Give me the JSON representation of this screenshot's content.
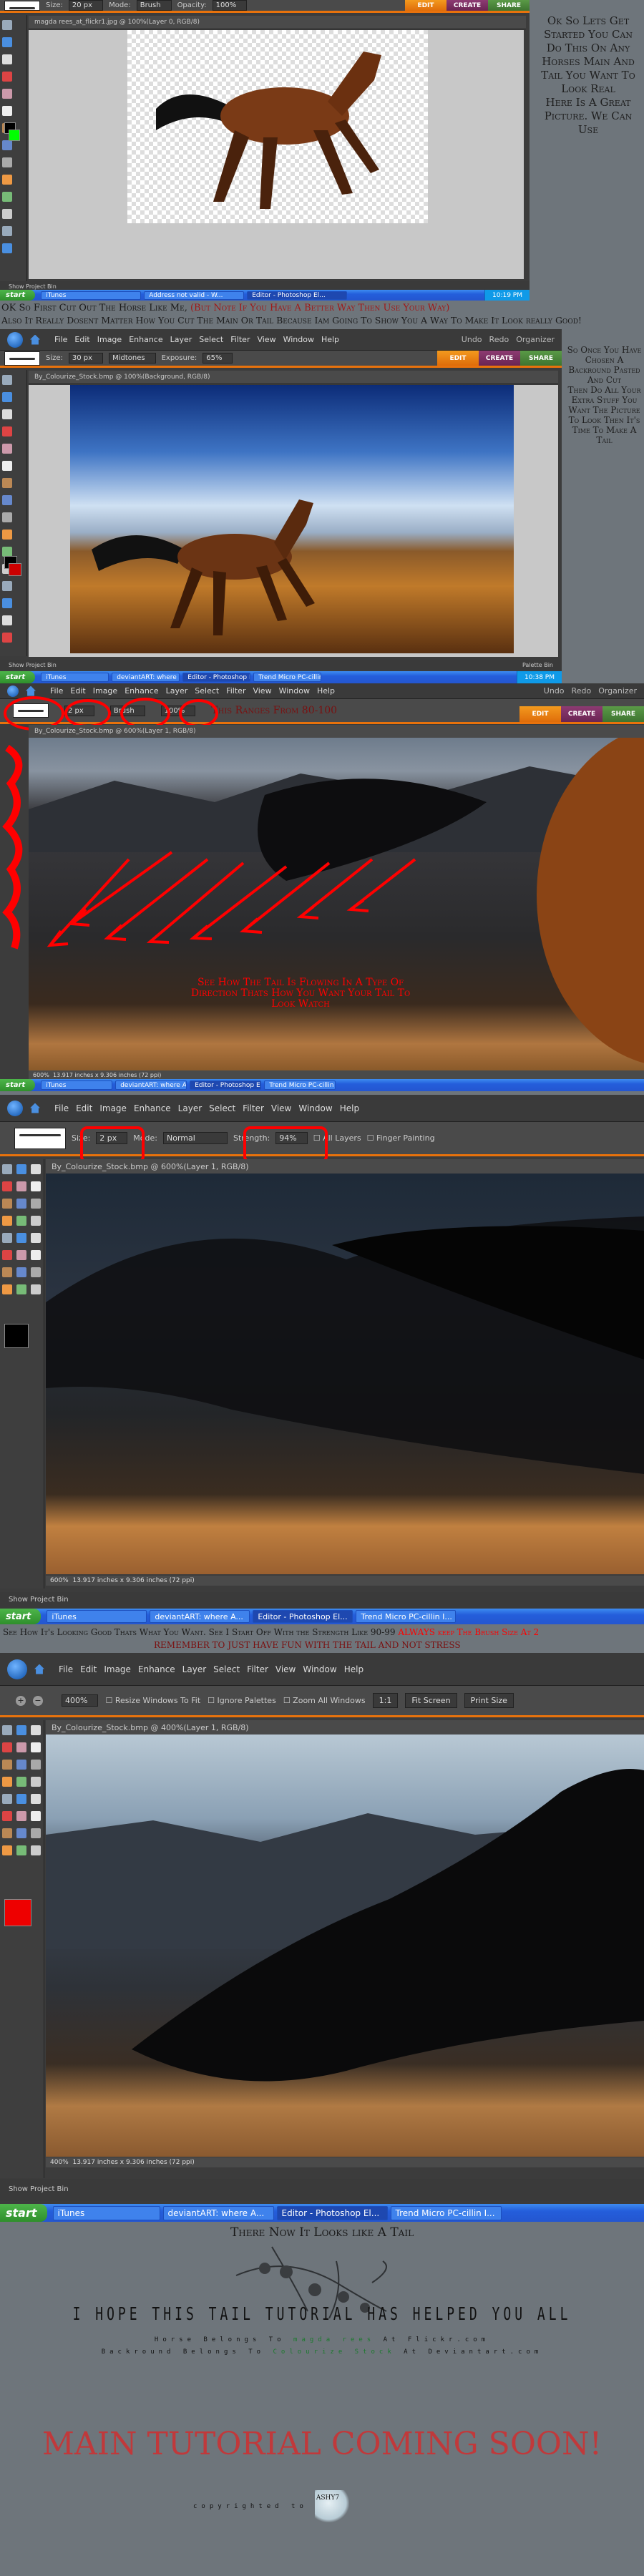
{
  "colors": {
    "background": "#6e757b",
    "accent_orange": "#e8720c",
    "red_note": "#ff0000",
    "dark_red": "#7a1010",
    "credit_green": "#1c7a2e",
    "banner_red": "#c0393b"
  },
  "menu": [
    "File",
    "Edit",
    "Image",
    "Enhance",
    "Layer",
    "Select",
    "Filter",
    "View",
    "Window",
    "Help"
  ],
  "header_right": {
    "undo": "Undo",
    "redo": "Redo",
    "organizer": "Organizer"
  },
  "mode_tabs": {
    "edit": "EDIT",
    "create": "CREATE",
    "share": "SHARE"
  },
  "taskbar": {
    "start": "start",
    "itunes": "iTunes",
    "deviantart": "deviantART: where A...",
    "address": "Address not valid - W...",
    "editor": "Editor - Photoshop El...",
    "trend": "Trend Micro PC-cillin I..."
  },
  "project_bin": "Show Project Bin",
  "palette_bin": "Palette Bin",
  "step1": {
    "options": {
      "size_label": "Size:",
      "size": "20 px",
      "mode_label": "Mode:",
      "mode": "Brush",
      "opacity_label": "Opacity:",
      "opacity": "100%"
    },
    "doc_title": "magda rees_at_flickr1.jpg @ 100%(Layer 0, RGB/8)",
    "clock": "10:19 PM",
    "side_text": "Ok So Lets Get Started You Can Do This On Any Horses Main And Tail You Want To Look Real\nHere Is A Great Picture.  We Can Use"
  },
  "caption1": {
    "line1_a": "OK So First Cut Out The Horse Like Me, ",
    "line1_b": "(But Note If You Have A Better Way Then Use Your Way)",
    "line2": "Also It Really Dosent Matter How You Cut The Main Or Tail Because Iam Going To Show You A Way To Make It Look really Good!"
  },
  "step2": {
    "options": {
      "size_label": "Size:",
      "size": "30 px",
      "range": "Midtones",
      "exposure_label": "Exposure:",
      "exposure": "65%"
    },
    "doc_title": "By_Colourize_Stock.bmp @ 100%(Background, RGB/8)",
    "clock": "10:38 PM",
    "side_text": "So Once You Have Chosen A Backround Pasted And Cut\nThen Do All Your Extra Stuff You Want The Picture To Look Then It's Time To Make A Tail"
  },
  "step3": {
    "options": {
      "size_label": "Size:",
      "size": "2 px",
      "mode": "Brush",
      "opacity_label": "Opacity:",
      "opacity": "100%"
    },
    "range_note": "This Ranges From 80-100",
    "doc_title": "By_Colourize_Stock.bmp @ 600%(Layer 1, RGB/8)",
    "note": "See How The Tail Is Flowing In A Type Of Direction Thats How You Want Your Tail To Look Watch",
    "zoom": "600%",
    "doc_size": "13.917 inches x 9.306 inches (72 ppi)"
  },
  "step4": {
    "options": {
      "size_label": "Size:",
      "size": "2 px",
      "mode_label": "Mode:",
      "mode": "Normal",
      "strength_label": "Strength:",
      "strength": "94%",
      "all_layers": "All Layers",
      "finger_painting": "Finger Painting"
    },
    "doc_title": "By_Colourize_Stock.bmp @ 600%(Layer 1, RGB/8)",
    "zoom": "600%",
    "doc_size": "13.917 inches x 9.306 inches (72 ppi)"
  },
  "caption2": {
    "line1_a": "See How It's Looking Good Thats What You Want. See I Start Off With the Strength Like 90-99 ",
    "line1_b": "ALWAYS keep The  Brush Size At 2",
    "line2": "REMEMBER TO JUST HAVE FUN WITH THE TAIL AND NOT STRESS"
  },
  "step5": {
    "options": {
      "zoom": "400%",
      "resize": "Resize Windows To Fit",
      "ignore": "Ignore Palettes",
      "zoom_all": "Zoom All Windows",
      "one_to_one": "1:1",
      "fit_screen": "Fit Screen",
      "print_size": "Print Size"
    },
    "doc_title": "By_Colourize_Stock.bmp @ 400%(Layer 1, RGB/8)",
    "zoom": "400%",
    "doc_size": "13.917 inches x 9.306 inches (72 ppi)"
  },
  "closing": {
    "there_now": "There Now It Looks like A Tail",
    "hope": "I HOPE THIS TAIL TUTORIAL HAS HELPED YOU ALL",
    "horse_a": "Horse Belongs To ",
    "horse_name": "magda rees",
    "horse_b": " At Flickr.com",
    "bg_a": "Backround Belongs To ",
    "bg_name": "Colourize Stock",
    "bg_b": " At Deviantart.com",
    "banner": "MAIN TUTORIAL COMING SOON!",
    "copyright": "copyrighted to ",
    "signature": "ASHY7"
  }
}
